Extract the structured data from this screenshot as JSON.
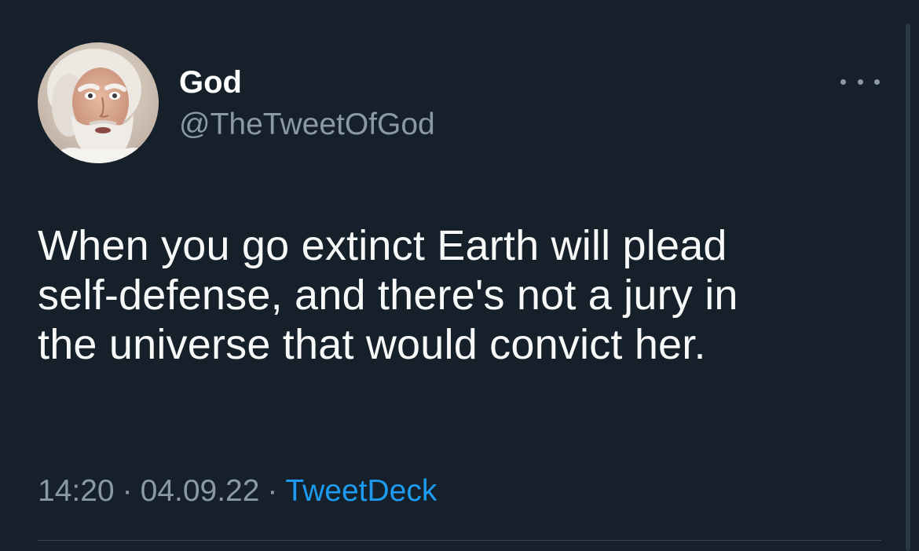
{
  "tweet": {
    "author": {
      "display_name": "God",
      "handle": "@TheTweetOfGod",
      "avatar_icon": "avatar-photo"
    },
    "text": "When you go extinct Earth will plead\nself-defense, and there's not a jury in\nthe universe that would convict her.",
    "time": "14:20",
    "separator": "·",
    "date": "04.09.22",
    "source": "TweetDeck",
    "more_icon": "more-options-icon"
  },
  "colors": {
    "background": "#15202b",
    "text_primary": "#f7f9f9",
    "text_secondary": "#8b98a5",
    "link": "#1d9bf0",
    "divider": "#38444d"
  }
}
